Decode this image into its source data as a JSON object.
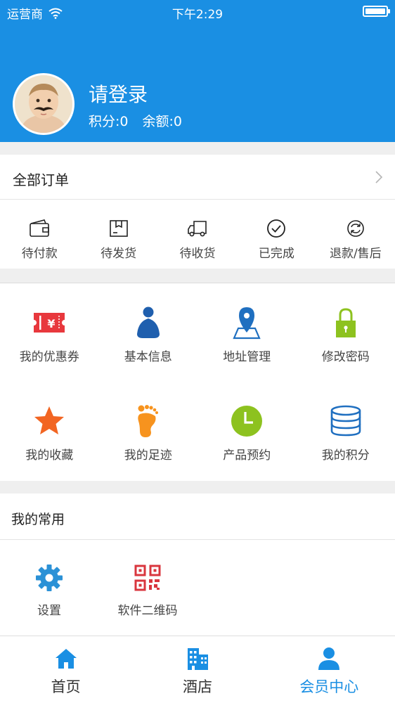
{
  "status_bar": {
    "carrier": "运营商",
    "time": "下午2:29",
    "icons": [
      "wifi-icon",
      "battery-icon"
    ]
  },
  "user": {
    "name": "请登录",
    "points": "积分:0",
    "balance": "余额:0",
    "avatar": "baby-with-mustache-avatar"
  },
  "orders": {
    "title": "全部订单",
    "items": [
      {
        "label": "待付款",
        "icon": "wallet-icon"
      },
      {
        "label": "待发货",
        "icon": "package-icon"
      },
      {
        "label": "待收货",
        "icon": "truck-icon"
      },
      {
        "label": "已完成",
        "icon": "check-circle-icon"
      },
      {
        "label": "退款/售后",
        "icon": "refund-icon"
      }
    ]
  },
  "features": [
    {
      "label": "我的优惠券",
      "icon": "coupon-icon",
      "color": "#e8383d"
    },
    {
      "label": "基本信息",
      "icon": "person-icon",
      "color": "#1f5fae"
    },
    {
      "label": "地址管理",
      "icon": "map-pin-icon",
      "color": "#1f6fc0"
    },
    {
      "label": "修改密码",
      "icon": "lock-icon",
      "color": "#8dc21f"
    },
    {
      "label": "我的收藏",
      "icon": "star-icon",
      "color": "#f26522"
    },
    {
      "label": "我的足迹",
      "icon": "footprint-icon",
      "color": "#f7931e"
    },
    {
      "label": "产品预约",
      "icon": "clock-icon",
      "color": "#8dc21f"
    },
    {
      "label": "我的积分",
      "icon": "coins-stack-icon",
      "color": "#1f6fc0"
    }
  ],
  "common": {
    "title": "我的常用",
    "items": [
      {
        "label": "设置",
        "icon": "gear-icon",
        "color": "#2b91d6"
      },
      {
        "label": "软件二维码",
        "icon": "qr-code-icon",
        "color": "#d9363e"
      }
    ]
  },
  "tabs": [
    {
      "label": "首页",
      "icon": "home-icon",
      "active": false
    },
    {
      "label": "酒店",
      "icon": "hotel-icon",
      "active": false
    },
    {
      "label": "会员中心",
      "icon": "member-icon",
      "active": true
    }
  ],
  "colors": {
    "brand": "#1a8fe3"
  }
}
